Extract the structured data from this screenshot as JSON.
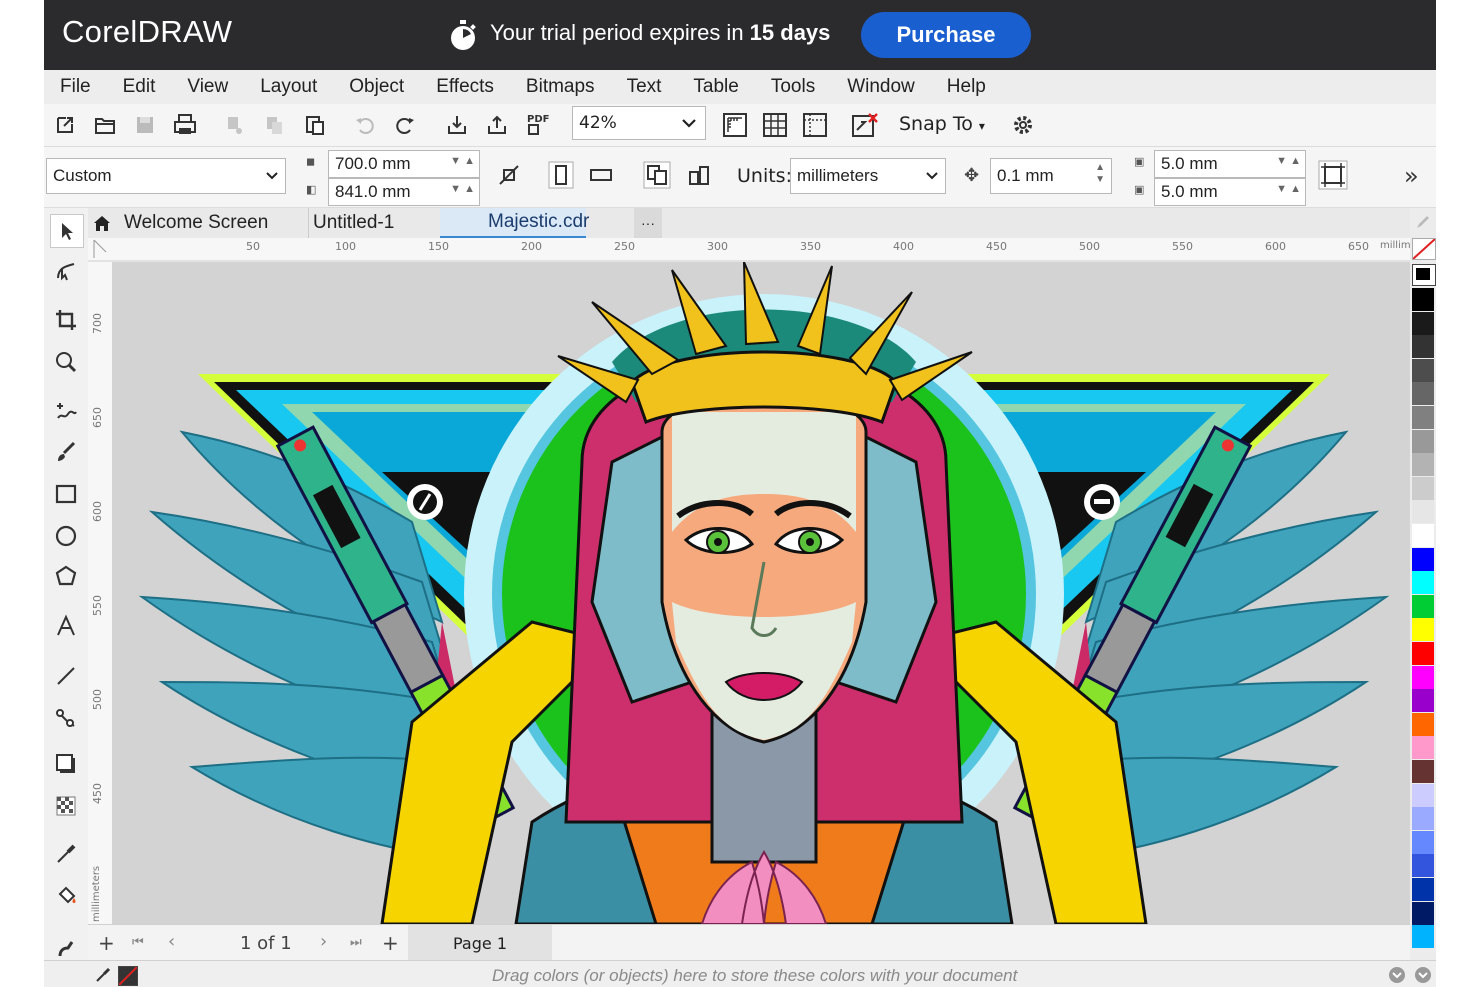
{
  "app": {
    "logo": "CorelDRAW"
  },
  "trial": {
    "prefix": "Your trial period expires in ",
    "days": "15 days",
    "purchase_label": "Purchase"
  },
  "menu": [
    "File",
    "Edit",
    "View",
    "Layout",
    "Object",
    "Effects",
    "Bitmaps",
    "Text",
    "Table",
    "Tools",
    "Window",
    "Help"
  ],
  "toolbar": {
    "zoom": "42%",
    "snap_label": "Snap To"
  },
  "property_bar": {
    "page_size": "Custom",
    "width": "700.0 mm",
    "height": "841.0 mm",
    "units_label": "Units:",
    "units": "millimeters",
    "nudge": "0.1 mm",
    "dup_x": "5.0 mm",
    "dup_y": "5.0 mm"
  },
  "tabs": {
    "welcome": "Welcome Screen",
    "untitled": "Untitled-1",
    "active": "Majestic.cdr",
    "more": "···"
  },
  "ruler": {
    "h_ticks": [
      "50",
      "100",
      "150",
      "200",
      "250",
      "300",
      "350",
      "400",
      "450",
      "500",
      "550",
      "600",
      "650"
    ],
    "h_unit": "millimeters",
    "v_ticks": [
      "700",
      "650",
      "600",
      "550",
      "500",
      "450"
    ],
    "v_unit": "millimeters"
  },
  "page_nav": {
    "of_text": "1  of  1",
    "page_tab": "Page 1"
  },
  "status": {
    "message": "Drag colors (or objects) here to store these colors with your document"
  },
  "palette_colors": [
    "#000000",
    "#1a1a1a",
    "#333333",
    "#4d4d4d",
    "#666666",
    "#808080",
    "#999999",
    "#b3b3b3",
    "#cccccc",
    "#e6e6e6",
    "#ffffff",
    "#0000ff",
    "#00ffff",
    "#00cc33",
    "#ffff00",
    "#ff0000",
    "#ff00ff",
    "#9900cc",
    "#ff6600",
    "#ff99cc",
    "#663333",
    "#ccccff",
    "#99aaff",
    "#6688ff",
    "#3355dd",
    "#0033aa",
    "#001a66",
    "#00b3ff"
  ]
}
